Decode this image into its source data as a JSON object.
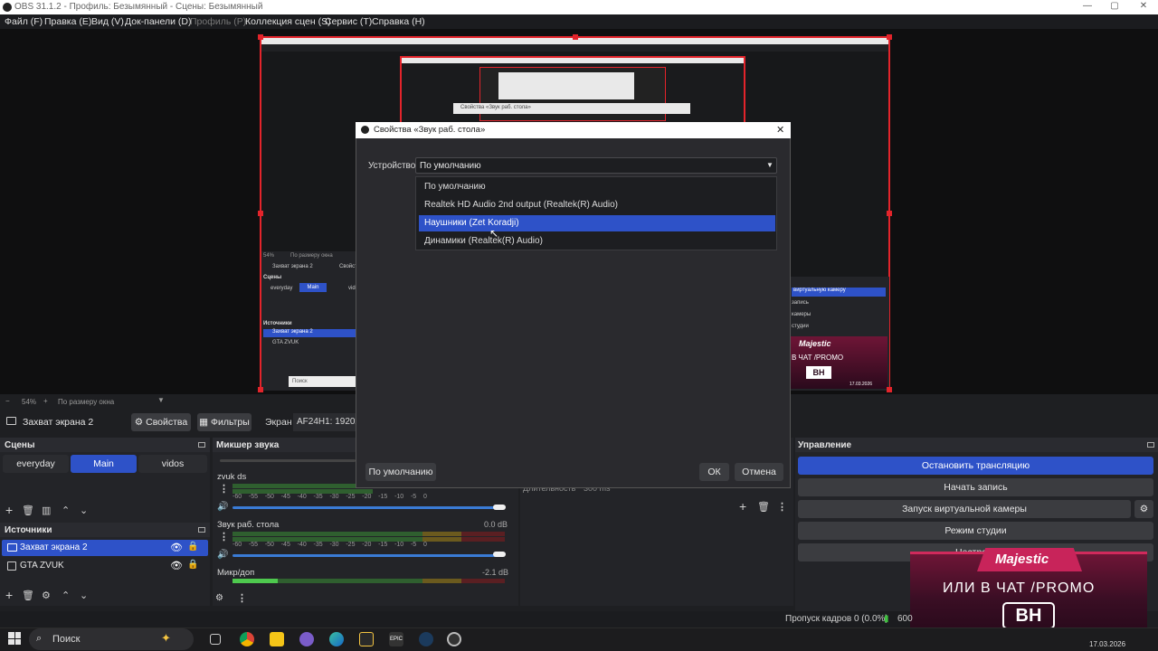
{
  "window": {
    "title": "OBS 31.1.2 - Профиль: Безымянный - Сцены: Безымянный",
    "min": "—",
    "max": "▢",
    "close": "✕"
  },
  "menu": {
    "file": "Файл (F)",
    "edit": "Правка (E)",
    "view": "Вид (V)",
    "docks": "Док-панели (D)",
    "profile": "Профиль (P)",
    "scenes": "Коллекция сцен (S)",
    "tools": "Сервис (T)",
    "help": "Справка (H)"
  },
  "preview": {
    "zoom": "54%",
    "fit": "По размеру окна",
    "nested_scene_label": "Захват экрана 2",
    "nested_props": "Свойства",
    "nested_scenes_title": "Сцены",
    "nested_scene_everyday": "everyday",
    "nested_scene_main": "Main",
    "nested_scene_vidos": "vidos",
    "nested_sources_title": "Источники",
    "nested_source_1": "Захват экрана 2",
    "nested_source_2": "GTA ZVUK",
    "nested_search": "Поиск",
    "nested_fit": "По размеру окна",
    "nested_zoom": "54%",
    "nested_dialog_title": "Свойства «Звук раб. стола»",
    "nested_control_1": "виртуальную камеру",
    "nested_control_2": "запись",
    "nested_control_3": "камеры",
    "nested_control_4": "студии",
    "nested_promo_brand": "Majestic",
    "nested_promo_text": "В ЧАТ /PROMO",
    "nested_promo_badge": "BH",
    "nested_promo_date": "17.03.2026"
  },
  "source_toolbar": {
    "source_name": "Захват экрана 2",
    "properties": "Свойства",
    "filters": "Фильтры",
    "screen_label": "Экран",
    "screen_value": "AF24H1: 1920x1080"
  },
  "scenes": {
    "title": "Сцены",
    "items": [
      {
        "label": "everyday",
        "active": false
      },
      {
        "label": "Main",
        "active": true
      },
      {
        "label": "vidos",
        "active": false
      }
    ]
  },
  "sources": {
    "title": "Источники",
    "items": [
      {
        "label": "Захват экрана 2",
        "active": true
      },
      {
        "label": "GTA ZVUK",
        "active": false
      }
    ]
  },
  "mixer": {
    "title": "Микшер звука",
    "channels": [
      {
        "name": "zvuk ds",
        "db": ""
      },
      {
        "name": "Звук раб. стола",
        "db": "0.0 dB"
      },
      {
        "name": "Микр/доп",
        "db": "-2.1 dB"
      }
    ],
    "ticks": [
      "-60",
      "-55",
      "-50",
      "-45",
      "-40",
      "-35",
      "-30",
      "-25",
      "-20",
      "-15",
      "-10",
      "-5",
      "0"
    ]
  },
  "transitions": {
    "duration_label": "Длительность",
    "duration_value": "300 ms"
  },
  "controls": {
    "title": "Управление",
    "stop_stream": "Остановить трансляцию",
    "start_record": "Начать запись",
    "virtual_cam": "Запуск виртуальной камеры",
    "studio_mode": "Режим студии",
    "settings": "Настройки"
  },
  "dialog": {
    "title": "Свойства «Звук раб. стола»",
    "device_label": "Устройство",
    "device_value": "По умолчанию",
    "options": [
      {
        "label": "По умолчанию",
        "selected": false
      },
      {
        "label": "Realtek HD Audio 2nd output (Realtek(R) Audio)",
        "selected": false
      },
      {
        "label": "Наушники (Zet Koradji)",
        "selected": true
      },
      {
        "label": "Динамики (Realtek(R) Audio)",
        "selected": false
      }
    ],
    "defaults_btn": "По умолчанию",
    "ok_btn": "ОК",
    "cancel_btn": "Отмена"
  },
  "statusbar": {
    "dropped": "Пропуск кадров 0 (0.0%)",
    "bitrate": "600"
  },
  "overlay": {
    "brand": "Majestic",
    "line": "ИЛИ В ЧАТ /PROMO",
    "badge": "BH"
  },
  "taskbar": {
    "search": "Поиск",
    "date": "17.03.2026"
  },
  "colors": {
    "accent": "#2e52c8",
    "record_red": "#e3242b",
    "promo_pink": "#c8245a"
  }
}
